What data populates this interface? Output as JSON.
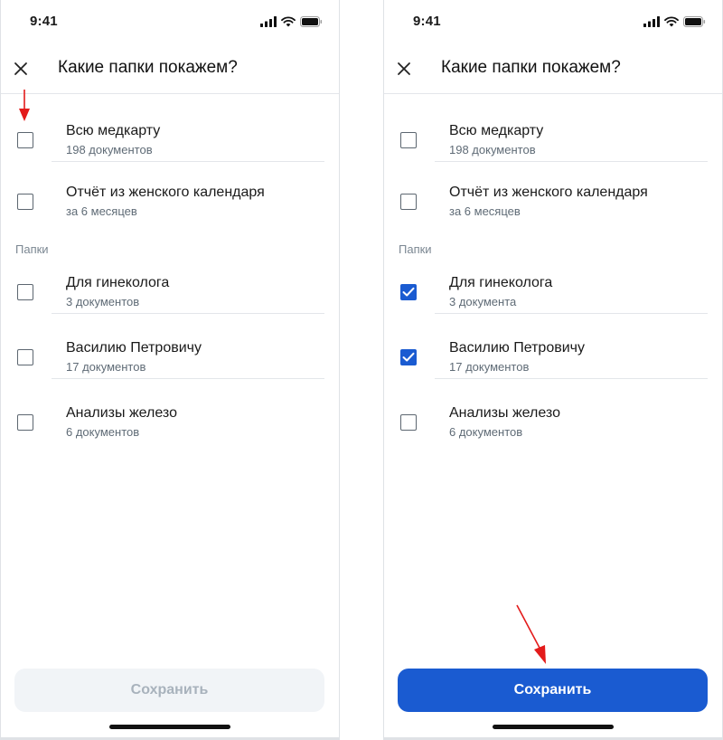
{
  "status_bar": {
    "time": "9:41"
  },
  "header": {
    "title": "Какие папки покажем?"
  },
  "items_top": [
    {
      "title": "Всю медкарту",
      "subtitle": "198 документов"
    },
    {
      "title": "Отчёт из женского календаря",
      "subtitle": "за 6 месяцев"
    }
  ],
  "section_label": "Папки",
  "left_screen": {
    "folders": [
      {
        "title": "Для гинеколога",
        "subtitle": "3 документов",
        "checked": false
      },
      {
        "title": "Василию Петровичу",
        "subtitle": "17 документов",
        "checked": false
      },
      {
        "title": "Анализы железо",
        "subtitle": "6 документов",
        "checked": false
      }
    ],
    "save_label": "Сохранить",
    "save_state": "disabled"
  },
  "right_screen": {
    "folders": [
      {
        "title": "Для гинеколога",
        "subtitle": "3 документа",
        "checked": true
      },
      {
        "title": "Василию Петровичу",
        "subtitle": "17 документов",
        "checked": true
      },
      {
        "title": "Анализы железо",
        "subtitle": "6 документов",
        "checked": false
      }
    ],
    "save_label": "Сохранить",
    "save_state": "active"
  },
  "icons": {
    "close": "close-icon",
    "signal": "cellular-signal-icon",
    "wifi": "wifi-icon",
    "battery": "battery-icon",
    "checkmark": "checkmark-icon",
    "annotation_arrow": "red-arrow-icon"
  },
  "colors": {
    "accent": "#1a5bd1",
    "disabled_button_bg": "#f1f4f7",
    "disabled_button_text": "#a8b2bc",
    "annotation": "#e31b1b"
  }
}
